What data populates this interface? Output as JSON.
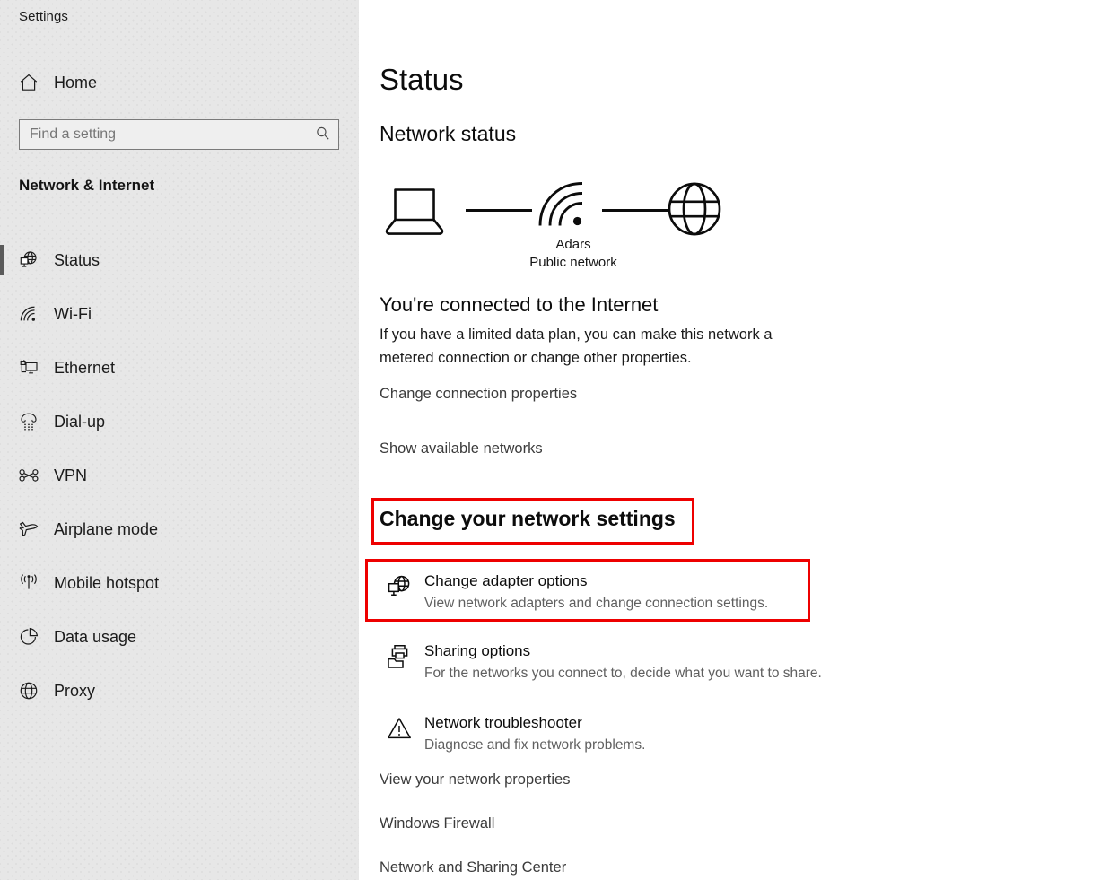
{
  "app": {
    "title": "Settings"
  },
  "sidebar": {
    "home_label": "Home",
    "home_icon": "home-icon",
    "search": {
      "placeholder": "Find a setting",
      "value": "",
      "icon": "search-icon"
    },
    "section_title": "Network & Internet",
    "items": [
      {
        "label": "Status",
        "icon": "globe-monitor-icon",
        "selected": true
      },
      {
        "label": "Wi-Fi",
        "icon": "wifi-icon",
        "selected": false
      },
      {
        "label": "Ethernet",
        "icon": "ethernet-icon",
        "selected": false
      },
      {
        "label": "Dial-up",
        "icon": "dialup-phone-icon",
        "selected": false
      },
      {
        "label": "VPN",
        "icon": "vpn-key-icon",
        "selected": false
      },
      {
        "label": "Airplane mode",
        "icon": "airplane-icon",
        "selected": false
      },
      {
        "label": "Mobile hotspot",
        "icon": "hotspot-icon",
        "selected": false
      },
      {
        "label": "Data usage",
        "icon": "pie-chart-icon",
        "selected": false
      },
      {
        "label": "Proxy",
        "icon": "globe-icon",
        "selected": false
      }
    ]
  },
  "main": {
    "page_title": "Status",
    "network_status_title": "Network status",
    "diagram": {
      "device_icon": "laptop-icon",
      "connection_icon": "wifi-icon",
      "internet_icon": "globe-icon",
      "network_name": "Adars",
      "network_type": "Public network"
    },
    "connection": {
      "heading": "You're connected to the Internet",
      "description": "If you have a limited data plan, you can make this network a metered connection or change other properties.",
      "change_properties_link": "Change connection properties",
      "show_networks_link": "Show available networks"
    },
    "change_settings_heading": "Change your network settings",
    "options": [
      {
        "title": "Change adapter options",
        "description": "View network adapters and change connection settings.",
        "icon": "globe-monitor-icon"
      },
      {
        "title": "Sharing options",
        "description": "For the networks you connect to, decide what you want to share.",
        "icon": "printer-folder-icon"
      },
      {
        "title": "Network troubleshooter",
        "description": "Diagnose and fix network problems.",
        "icon": "warning-triangle-icon"
      }
    ],
    "bottom_links": [
      "View your network properties",
      "Windows Firewall",
      "Network and Sharing Center"
    ]
  },
  "annotations": {
    "highlight_color": "#ee0000",
    "boxes": [
      {
        "target": "change-your-network-settings-heading"
      },
      {
        "target": "change-adapter-options-row"
      }
    ]
  },
  "colors": {
    "sidebar_bg": "#e7e7e7",
    "main_bg": "#ffffff",
    "text": "#1b1b1b",
    "muted_text": "#606060",
    "selection_bar": "#5a5a5a",
    "highlight": "#ee0000"
  }
}
